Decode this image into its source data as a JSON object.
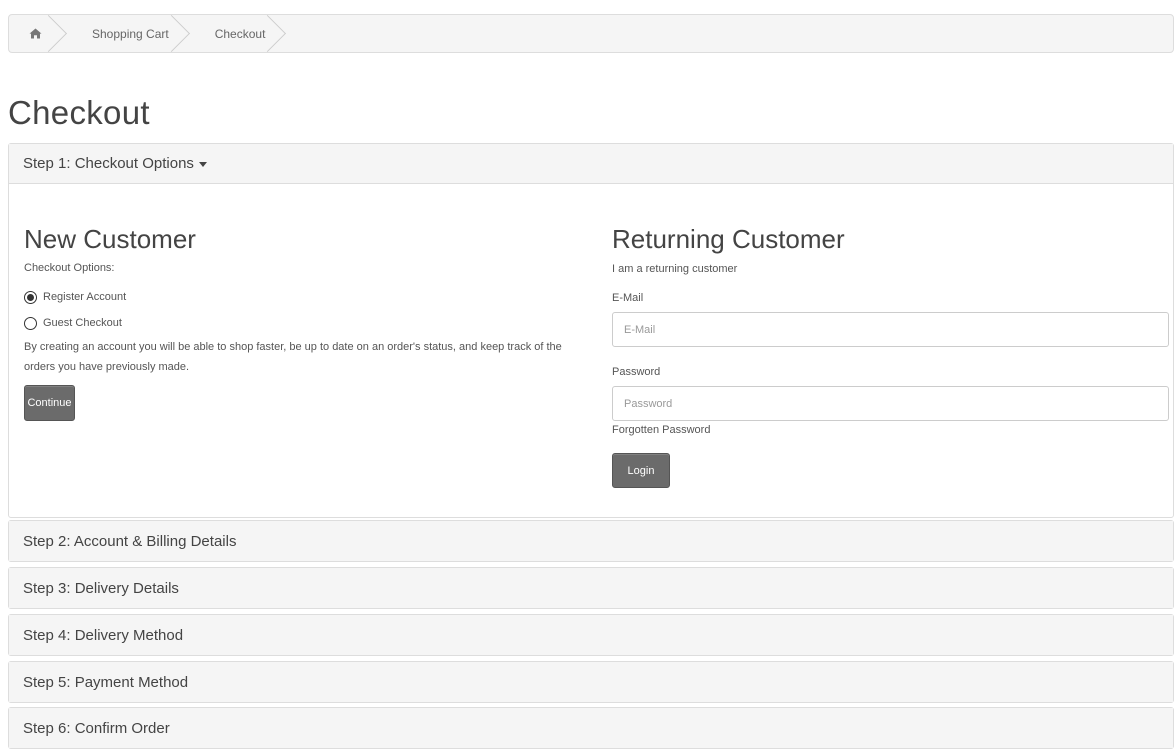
{
  "breadcrumb": {
    "home_icon": "home-icon",
    "items": [
      "Shopping Cart",
      "Checkout"
    ]
  },
  "page": {
    "title": "Checkout"
  },
  "step1": {
    "title": "Step 1: Checkout Options",
    "new_customer": {
      "heading": "New Customer",
      "options_label": "Checkout Options:",
      "options": [
        {
          "label": "Register Account",
          "selected": true
        },
        {
          "label": "Guest Checkout",
          "selected": false
        }
      ],
      "description": "By creating an account you will be able to shop faster, be up to date on an order's status, and keep track of the orders you have previously made.",
      "continue_label": "Continue"
    },
    "returning_customer": {
      "heading": "Returning Customer",
      "subtitle": "I am a returning customer",
      "email_label": "E-Mail",
      "email_placeholder": "E-Mail",
      "email_value": "",
      "password_label": "Password",
      "password_placeholder": "Password",
      "password_value": "",
      "forgot_label": "Forgotten Password",
      "login_label": "Login"
    }
  },
  "steps": [
    {
      "title": "Step 2: Account & Billing Details"
    },
    {
      "title": "Step 3: Delivery Details"
    },
    {
      "title": "Step 4: Delivery Method"
    },
    {
      "title": "Step 5: Payment Method"
    },
    {
      "title": "Step 6: Confirm Order"
    }
  ],
  "colors": {
    "button_bg": "#6b6b6b",
    "panel_heading_bg": "#f5f5f5",
    "border": "#dddddd"
  }
}
